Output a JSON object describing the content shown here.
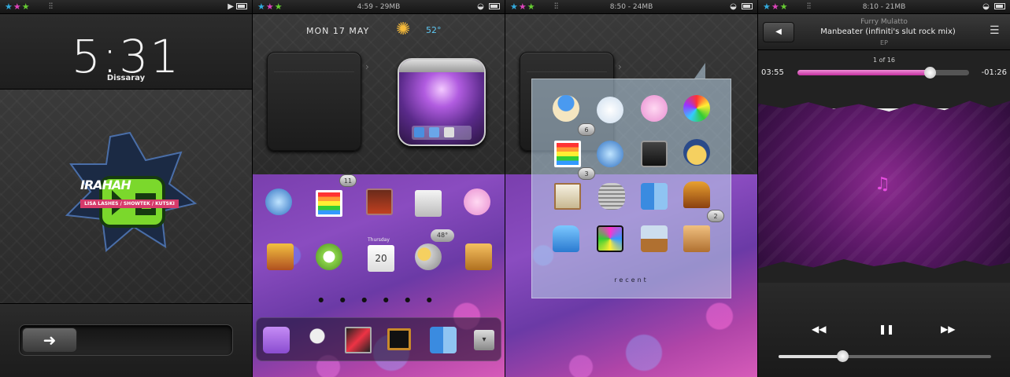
{
  "screens": [
    {
      "status": {
        "center": "",
        "icons": [
          "stars-icon",
          "audio-wave-icon",
          "play-icon",
          "battery-icon"
        ]
      },
      "lock": {
        "time": "5:31",
        "subtitle": "Dissaray",
        "logo_text": "IRAHAH",
        "logo_band": "LISA LASHES / SHOWTEK / KUTSKI"
      },
      "unlock_arrow": "➜"
    },
    {
      "status": {
        "center": "4:59 - 29MB"
      },
      "date": "MON 17 MAY",
      "temperature": "52°",
      "badges": [
        "11"
      ],
      "weather_pill": "48°",
      "calendar_day": "Thursday",
      "calendar_date": "20",
      "page_dots": "● ● ● ● ● ●"
    },
    {
      "status": {
        "center": "8:50 - 24MB"
      },
      "badges": [
        "6",
        "3",
        "2"
      ],
      "recent_label": "recent"
    },
    {
      "status": {
        "center": "8:10 - 21MB"
      },
      "player": {
        "artist": "Furry Mulatto",
        "title": "Manbeater (infiniti's slut rock mix)",
        "album": "EP",
        "track_count": "1 of 16",
        "elapsed": "03:55",
        "remaining": "-01:26",
        "progress": 0.77,
        "volume": 0.3
      }
    }
  ],
  "colors": {
    "accent_pink": "#d63aa8",
    "accent_blue": "#5ec5f0",
    "weather_sun": "#f5b93a"
  }
}
